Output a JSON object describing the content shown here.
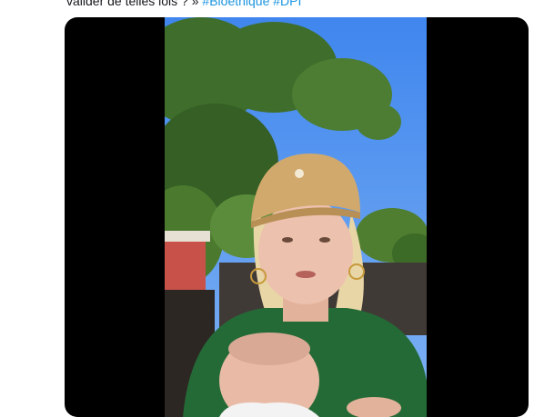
{
  "tweet": {
    "text_prefix": "valider de telles lois ? »",
    "hashtags": [
      "#Bioethique",
      "#DPI"
    ]
  },
  "video": {
    "scene": "outdoor-selfie-video-thumbnail",
    "colors": {
      "sky": "#4a8ef0",
      "foliage": "#3f6e2c",
      "cap": "#d1a96c",
      "hair": "#e8d6a6",
      "shirt": "#246a36",
      "skin": "#e9bba6"
    }
  }
}
